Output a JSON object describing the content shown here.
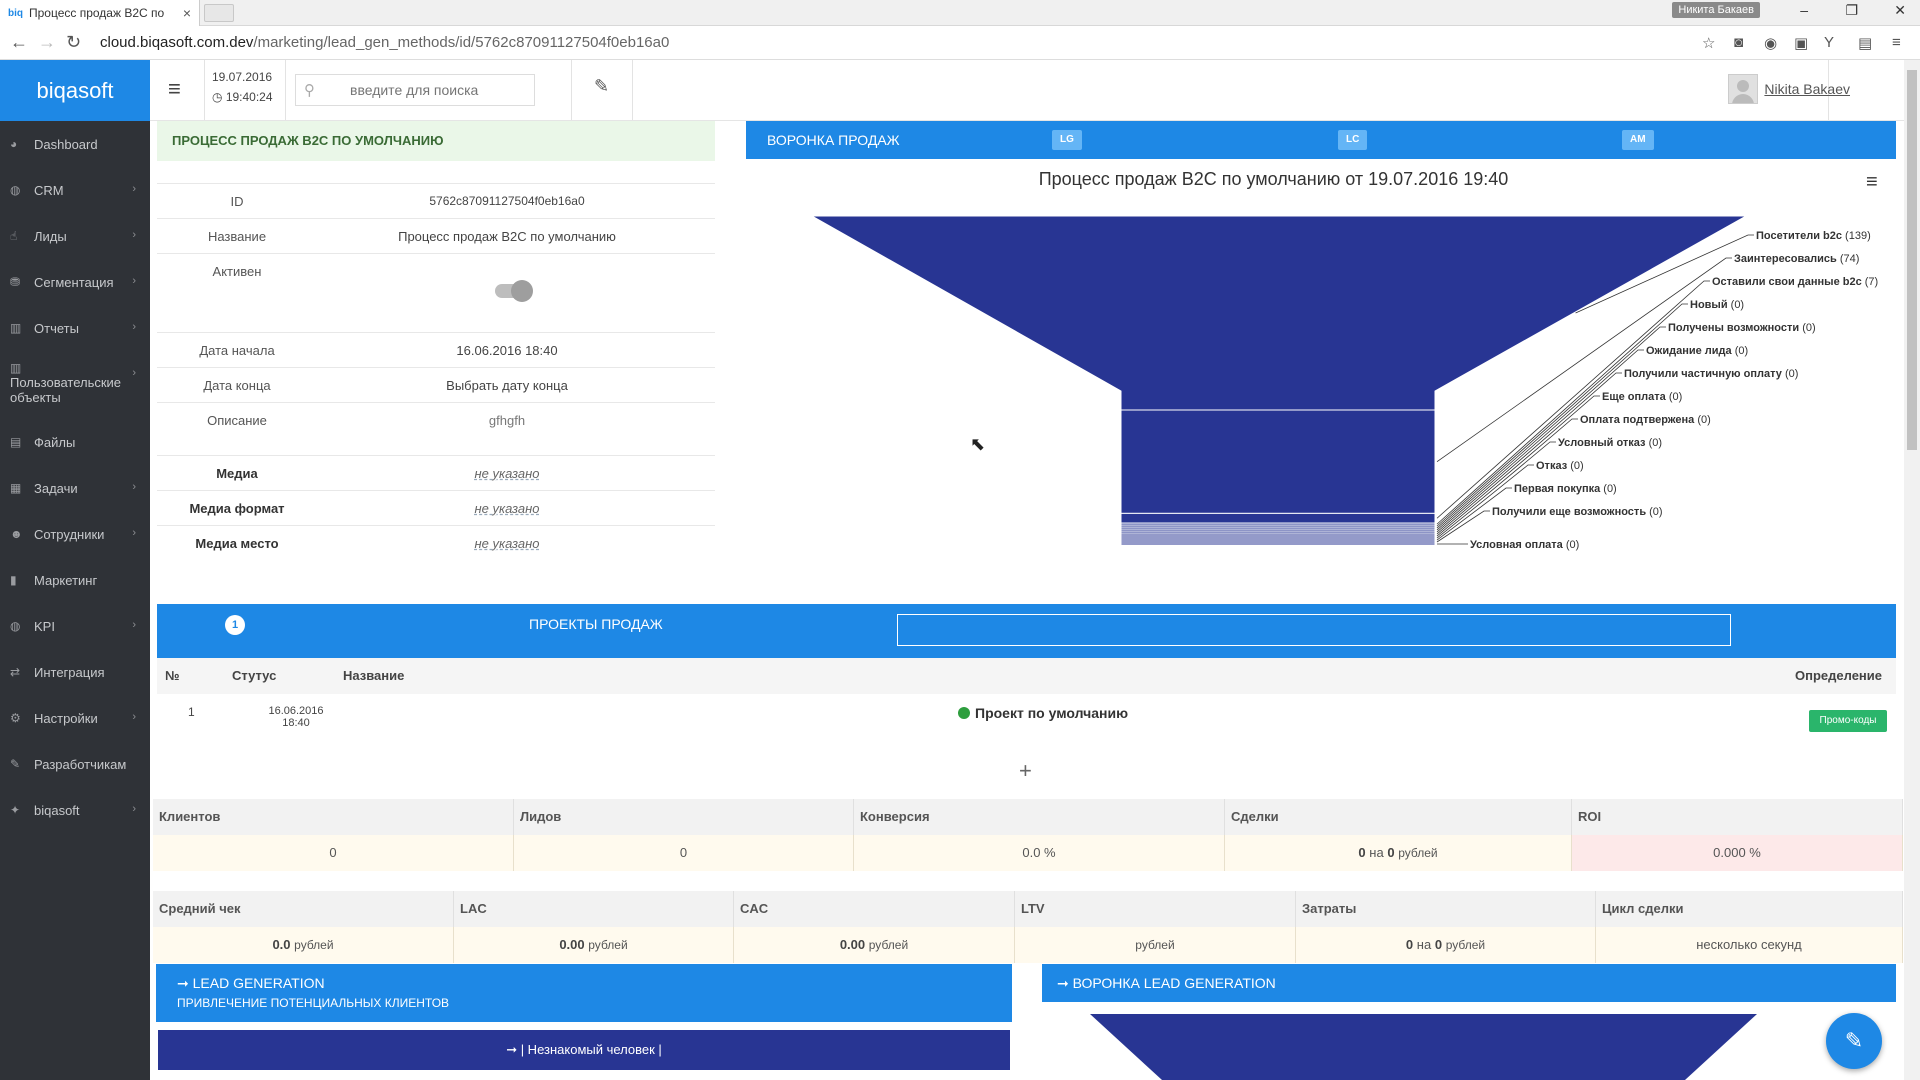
{
  "browser": {
    "tab_title": "Процесс продаж B2C по",
    "favicon": "biq",
    "profile": "Никита Бакаев",
    "url_host": "cloud.biqasoft.com.dev",
    "url_path": "/marketing/lead_gen_methods/id/5762c87091127504f0eb16a0"
  },
  "header": {
    "logo": "biqasoft",
    "date": "19.07.2016",
    "time": "19:40:24",
    "search_placeholder": "введите для поиска",
    "user_name": "Nikita Bakaev"
  },
  "sidebar": {
    "items": [
      {
        "label": "Dashboard",
        "icon": "dashboard-icon",
        "chevron": false
      },
      {
        "label": "CRM",
        "icon": "crm-icon",
        "chevron": true
      },
      {
        "label": "Лиды",
        "icon": "leads-icon",
        "chevron": true
      },
      {
        "label": "Сегментация",
        "icon": "segment-icon",
        "chevron": true
      },
      {
        "label": "Отчеты",
        "icon": "reports-icon",
        "chevron": true
      },
      {
        "label": "Пользовательские объекты",
        "icon": "objects-icon",
        "chevron": true
      },
      {
        "label": "Файлы",
        "icon": "files-icon",
        "chevron": false
      },
      {
        "label": "Задачи",
        "icon": "tasks-icon",
        "chevron": true
      },
      {
        "label": "Сотрудники",
        "icon": "employees-icon",
        "chevron": true
      },
      {
        "label": "Маркетинг",
        "icon": "marketing-icon",
        "chevron": false
      },
      {
        "label": "KPI",
        "icon": "kpi-icon",
        "chevron": true
      },
      {
        "label": "Интеграция",
        "icon": "integration-icon",
        "chevron": false
      },
      {
        "label": "Настройки",
        "icon": "settings-icon",
        "chevron": true
      },
      {
        "label": "Разработчикам",
        "icon": "developers-icon",
        "chevron": false
      },
      {
        "label": "biqasoft",
        "icon": "pin-icon",
        "chevron": true
      }
    ]
  },
  "process": {
    "title": "ПРОЦЕСС ПРОДАЖ B2C ПО УМОЛЧАНИЮ",
    "id_label": "ID",
    "id_value": "5762c87091127504f0eb16a0",
    "name_label": "Название",
    "name_value": "Процесс продаж B2C по умолчанию",
    "active_label": "Активен",
    "active": true,
    "start_label": "Дата начала",
    "start_value": "16.06.2016 18:40",
    "end_label": "Дата конца",
    "end_value": "Выбрать дату конца",
    "desc_label": "Описание",
    "desc_value": "gfhgfh",
    "media_label": "Медиа",
    "media_value": "не указано",
    "media_format_label": "Медиа формат",
    "media_format_value": "не указано",
    "media_place_label": "Медиа место",
    "media_place_value": "не указано"
  },
  "funnel": {
    "header": "ВОРОНКА ПРОДАЖ",
    "badges": [
      "LG",
      "LC",
      "AM"
    ],
    "chart_title": "Процесс продаж B2C по умолчанию от 19.07.2016 19:40"
  },
  "chart_data": {
    "type": "funnel",
    "title": "Процесс продаж B2C по умолчанию от 19.07.2016 19:40",
    "color": "#283593",
    "stages": [
      {
        "name": "Посетители b2c",
        "value": 139
      },
      {
        "name": "Заинтересовались",
        "value": 74
      },
      {
        "name": "Оставили свои данные b2c",
        "value": 7
      },
      {
        "name": "Новый",
        "value": 0
      },
      {
        "name": "Получены возможности",
        "value": 0
      },
      {
        "name": "Ожидание лида",
        "value": 0
      },
      {
        "name": "Получили частичную оплату",
        "value": 0
      },
      {
        "name": "Еще оплата",
        "value": 0
      },
      {
        "name": "Оплата подтвержена",
        "value": 0
      },
      {
        "name": "Условный отказ",
        "value": 0
      },
      {
        "name": "Отказ",
        "value": 0
      },
      {
        "name": "Первая покупка",
        "value": 0
      },
      {
        "name": "Получили еще возможность",
        "value": 0
      },
      {
        "name": "Условная оплата",
        "value": 0
      }
    ]
  },
  "projects": {
    "title": "ПРОЕКТЫ ПРОДАЖ",
    "count": "1",
    "columns": {
      "num": "№",
      "status": "Стутус",
      "name": "Название",
      "definition": "Определение"
    },
    "rows": [
      {
        "num": "1",
        "date": "16.06.2016",
        "time": "18:40",
        "name": "Проект по умолчанию",
        "tag": "Промо-коды"
      }
    ]
  },
  "stats1": {
    "headers": [
      "Клиентов",
      "Лидов",
      "Конверсия",
      "Сделки",
      "ROI"
    ],
    "clients": "0",
    "leads": "0",
    "conversion": "0.0 %",
    "deals_a": "0",
    "deals_mid": "на",
    "deals_b": "0",
    "deals_unit": "рублей",
    "roi": "0.000 %"
  },
  "stats2": {
    "headers": [
      "Средний чек",
      "LAC",
      "CAC",
      "LTV",
      "Затраты",
      "Цикл сделки"
    ],
    "avg": "0.0",
    "lac": "0.00",
    "cac": "0.00",
    "unit": "рублей",
    "costs_a": "0",
    "costs_mid": "на",
    "costs_b": "0",
    "cycle": "несколько секунд"
  },
  "leadgen": {
    "title": "➞ LEAD GENERATION",
    "subtitle": "ПРИВЛЕЧЕНИЕ ПОТЕНЦИАЛЬНЫХ КЛИЕНТОВ",
    "stranger": "➞ | Незнакомый человек |",
    "funnel_title": "➞ ВОРОНКА LEAD GENERATION"
  }
}
